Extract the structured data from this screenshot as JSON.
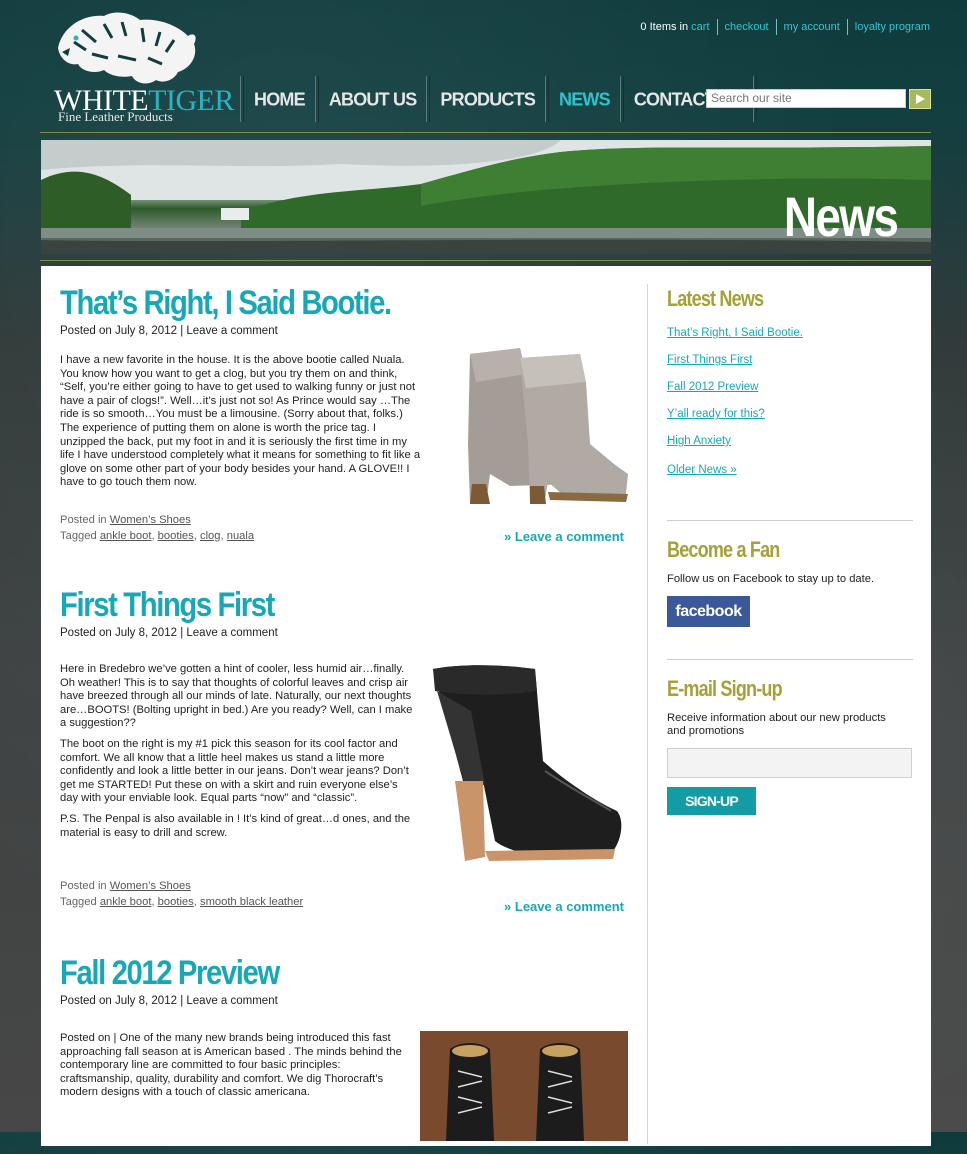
{
  "brand": {
    "name_part1": "WHITE",
    "name_part2": "TIGER",
    "tagline": "Fine Leather Products"
  },
  "toplinks": {
    "cart_count": "0 Items in",
    "cart": "cart",
    "checkout": "checkout",
    "account": "my account",
    "loyalty": "loyalty program"
  },
  "nav": [
    {
      "label": "HOME"
    },
    {
      "label": "ABOUT US"
    },
    {
      "label": "PRODUCTS"
    },
    {
      "label": "NEWS"
    },
    {
      "label": "CONTACT US"
    }
  ],
  "search": {
    "placeholder": "Search our site"
  },
  "banner": {
    "title": "News"
  },
  "posts": [
    {
      "title": "That’s Right, I Said Bootie.",
      "meta": "Posted on July 8, 2012 | Leave a comment",
      "body": [
        "I have a new favorite in the house.  It is the above bootie called Nuala.  You know how you want to get a clog, but you try them on and think, “Self, you’re either going to have to get used to walking funny or just not have a pair of clogs!”.  Well…it’s just not so!  As Prince would say …The ride is so smooth…You must be a limousine.  (Sorry about that, folks.) The experience of putting them on alone is worth the price tag.  I unzipped the back, put my foot in and it is seriously the first time in my life I have understood completely what it means for something to fit like a glove on some other part of your body besides your hand.  A GLOVE!!  I have to go touch them now."
      ],
      "posted_in_label": "Posted in",
      "category": "Women’s Shoes",
      "tagged_label": "Tagged",
      "tags": [
        "ankle boot",
        "booties",
        "clog",
        "nuala"
      ],
      "leave": "» Leave a comment"
    },
    {
      "title": "First Things First",
      "meta": "Posted on July 8, 2012 | Leave a comment",
      "body": [
        "Here in Bredebro we’ve gotten a hint of cooler, less humid air…finally. Oh weather!  This is to say that thoughts of colorful leaves and crisp air have breezed through all our minds of late.  Naturally, our next thoughts are…BOOTS!  (Bolting upright in bed.)  Are you ready?  Well, can I make a suggestion??",
        "The boot on the right is my #1 pick this season for its cool factor and comfort.  We all know that a little heel makes us stand a little more confidently and look a little better in our jeans.  Don’t wear jeans?  Don’t get me STARTED!  Put these on with a skirt and ruin everyone else’s day with your enviable look.  Equal parts “now” and “classic”.",
        "P.S. The Penpal is also available in !  It’s kind of great…d ones, and the material is easy to drill and screw."
      ],
      "posted_in_label": "Posted in",
      "category": "Women’s Shoes",
      "tagged_label": "Tagged",
      "tags": [
        "ankle boot",
        "booties",
        "smooth black leather"
      ],
      "leave": "» Leave a comment"
    },
    {
      "title": "Fall 2012 Preview",
      "meta": "Posted on July 8, 2012 | Leave a comment",
      "body": [
        "Posted on  | One of the many new brands being introduced this fast approaching fall season at  is American based . The minds behind the contemporary line are committed to four basic principles: craftsmanship, quality, durability and comfort. We dig Thorocraft’s modern designs with a touch of classic americana."
      ]
    }
  ],
  "sidebar": {
    "latest_title": "Latest News",
    "latest_links": [
      "That’s Right, I Said Bootie.",
      "First Things First",
      "Fall 2012 Preview",
      "Y’all ready for this?",
      "High Anxiety"
    ],
    "older": "Older News »",
    "fan_title": "Become a Fan",
    "fan_text": "Follow us on Facebook to stay up to date.",
    "facebook": "facebook",
    "email_title": "E-mail Sign-up",
    "email_text": "Receive information about our new products and promotions",
    "signup": "SIGN-UP"
  }
}
